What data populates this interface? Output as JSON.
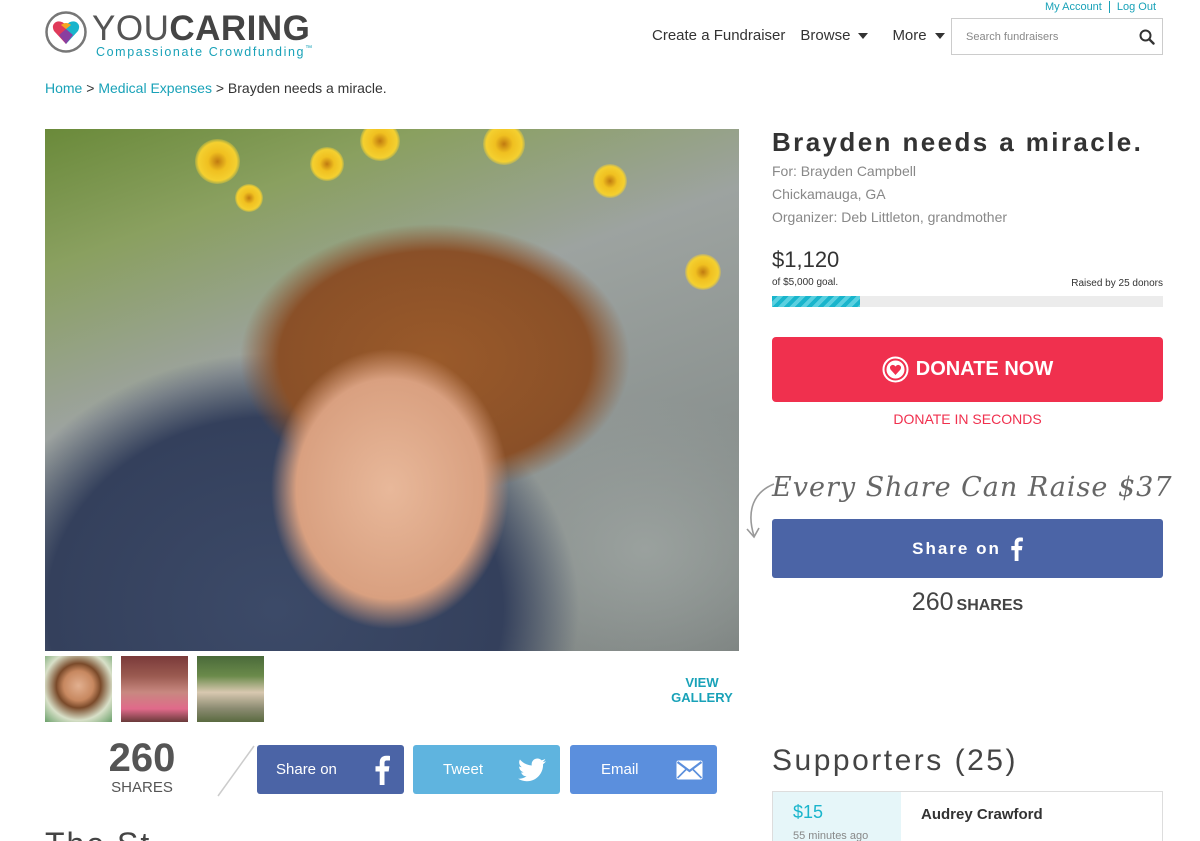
{
  "account": {
    "my_account": "My Account",
    "log_out": "Log Out"
  },
  "logo": {
    "word_light": "YOU",
    "word_bold": "CARING",
    "tagline": "Compassionate Crowdfunding",
    "tm": "™"
  },
  "nav": {
    "create": "Create a Fundraiser",
    "browse": "Browse",
    "more": "More"
  },
  "search": {
    "placeholder": "Search fundraisers",
    "value": ""
  },
  "breadcrumb": {
    "home": "Home",
    "category": "Medical Expenses",
    "current": "Brayden needs a miracle.",
    "sep": ">"
  },
  "gallery": {
    "view_line1": "VIEW",
    "view_line2": "GALLERY"
  },
  "share_strip": {
    "count": "260",
    "count_label": "SHARES",
    "facebook_label": "Share on",
    "tweet_label": "Tweet",
    "email_label": "Email"
  },
  "story": {
    "heading_peek": "The St"
  },
  "campaign": {
    "title": "Brayden needs a miracle.",
    "for": "For: Brayden Campbell",
    "location": "Chickamauga, GA",
    "organizer": "Organizer: Deb Littleton, grandmother",
    "raised": "$1,120",
    "goal": "of $5,000 goal.",
    "donors": "Raised by 25 donors",
    "progress_fraction": 0.224
  },
  "donate": {
    "button_label": "DONATE NOW",
    "seconds_label": "DONATE IN SECONDS"
  },
  "share_box": {
    "tagline": "Every Share Can Raise $37",
    "button_label": "Share on",
    "total": "260",
    "total_label": "SHARES"
  },
  "supporters": {
    "heading": "Supporters (25)",
    "items": [
      {
        "amount": "$15",
        "time": "55 minutes ago",
        "name": "Audrey Crawford"
      }
    ]
  },
  "colors": {
    "accent": "#19a2b8",
    "donate": "#f0304e",
    "facebook": "#4b64a6",
    "twitter": "#5fb4df",
    "email": "#5b8fdd"
  },
  "icons": [
    "heart-logo-icon",
    "search-icon",
    "facebook-icon",
    "twitter-icon",
    "email-icon",
    "donate-heart-icon",
    "curved-arrow-icon"
  ]
}
